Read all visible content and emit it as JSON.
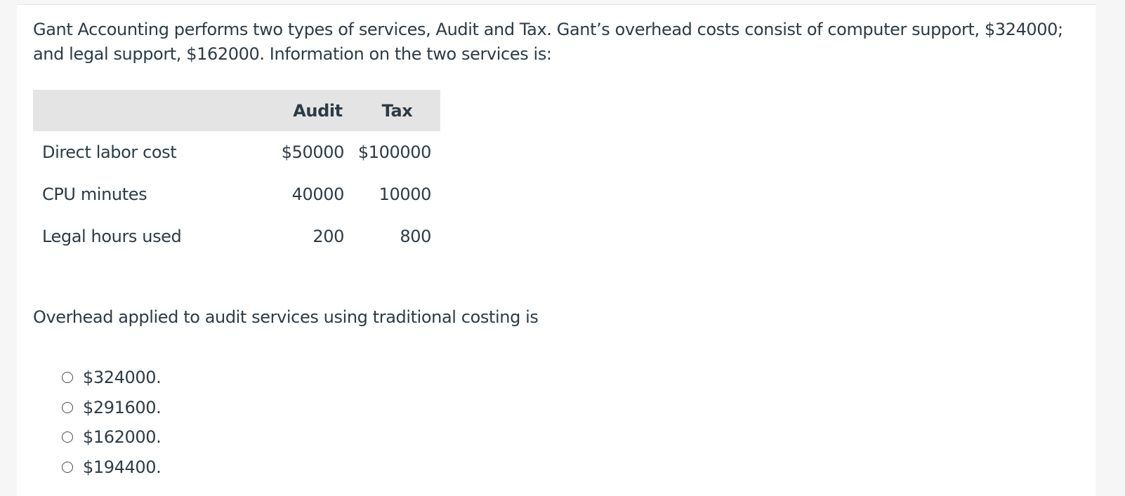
{
  "question": {
    "text": "Gant Accounting performs two types of services, Audit and Tax. Gant’s overhead costs consist of computer support, $324000; and legal support, $162000. Information on the two services is:",
    "prompt": "Overhead applied to audit services using traditional costing is"
  },
  "table": {
    "headers": [
      "",
      "Audit",
      "Tax"
    ],
    "rows": [
      {
        "label": "Direct labor cost",
        "audit": "$50000",
        "tax": "$100000"
      },
      {
        "label": "CPU minutes",
        "audit": "40000",
        "tax": "10000"
      },
      {
        "label": "Legal hours used",
        "audit": "200",
        "tax": "800"
      }
    ]
  },
  "answers": [
    {
      "label": "$324000."
    },
    {
      "label": "$291600."
    },
    {
      "label": "$162000."
    },
    {
      "label": "$194400."
    }
  ],
  "colors": {
    "text": "#2d3b45",
    "table_header_bg": "#e4e4e4",
    "page_bg": "#f6f6f6"
  }
}
